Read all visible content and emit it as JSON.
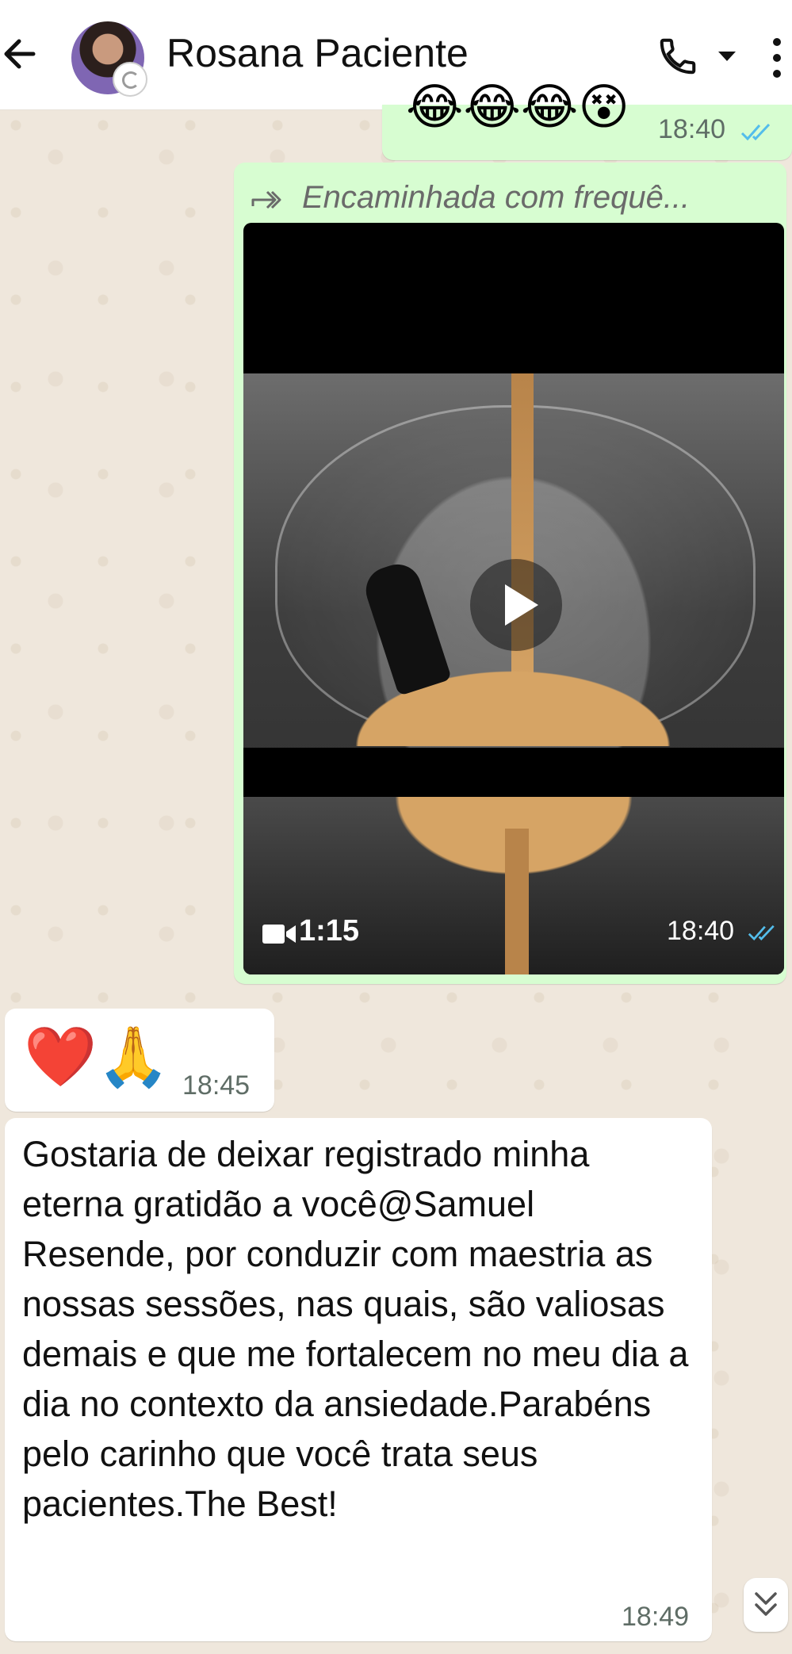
{
  "header": {
    "title": "Rosana Paciente"
  },
  "messages": {
    "m1": {
      "emojis": "😂😂😂😵",
      "time": "18:40"
    },
    "m2": {
      "forwarded_label": "Encaminhada com frequê...",
      "video_duration": "1:15",
      "time": "18:40"
    },
    "m3": {
      "emojis": "❤️🙏",
      "time": "18:45"
    },
    "m4": {
      "text": "Gostaria de deixar registrado minha eterna gratidão a você@Samuel Resende, por conduzir com maestria as nossas sessões, nas quais, são valiosas demais e que me fortalecem no meu dia a dia no contexto da ansiedade.Parabéns pelo carinho que você trata seus pacientes.The Best!",
      "time": "18:49"
    }
  },
  "colors": {
    "outgoing_bubble": "#d7fdd1",
    "incoming_bubble": "#ffffff",
    "read_ticks": "#53bdeb",
    "wallpaper": "#efe7dc"
  },
  "icons": {
    "back": "arrow-left-icon",
    "call": "phone-icon",
    "menu": "more-vertical-icon",
    "forward": "forward-icon",
    "video": "video-camera-icon",
    "scroll": "chevron-double-down-icon"
  }
}
